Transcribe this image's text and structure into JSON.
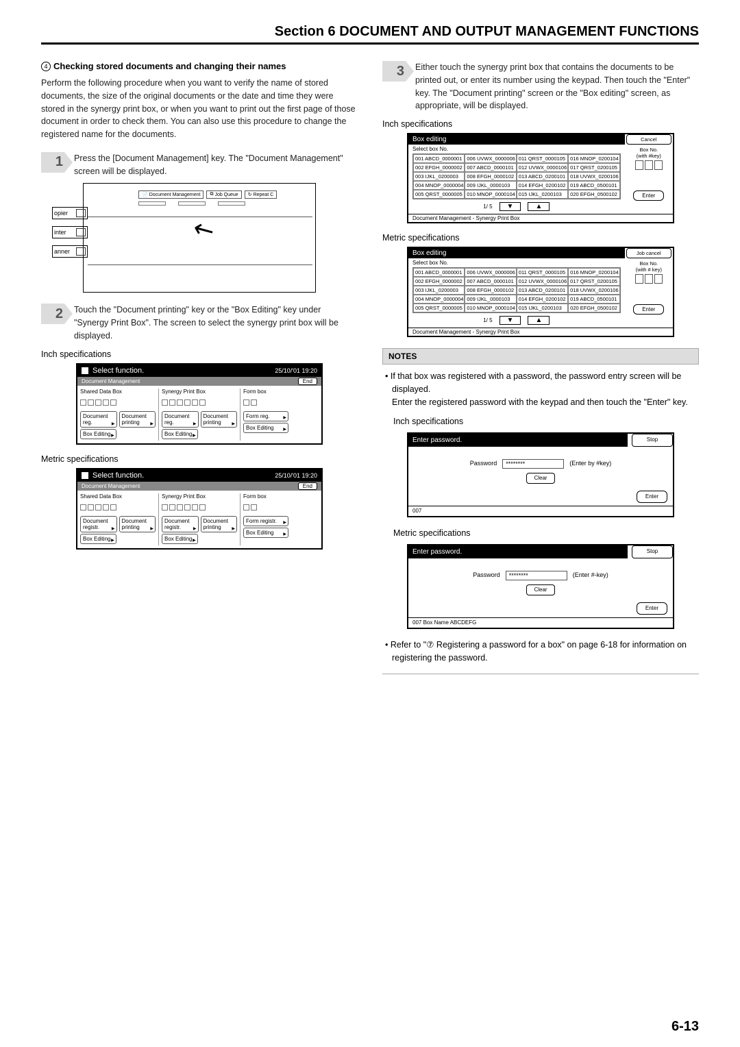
{
  "section_header": "Section 6  DOCUMENT AND OUTPUT MANAGEMENT FUNCTIONS",
  "left": {
    "sub_num": "4",
    "sub_title": "Checking stored documents and changing their names",
    "intro": "Perform the following procedure when you want to verify the name of stored documents, the size of the original documents or the date and time they were stored in the synergy print box, or when you want to print out the first page of those document in order to check them. You can also use this procedure to change the registered name for the documents.",
    "step1": "Press the [Document Management] key. The \"Document Management\" screen will be displayed.",
    "step2": "Touch the \"Document printing\" key or the \"Box Editing\" key under \"Synergy Print Box\". The screen to select the synergy print box will be displayed.",
    "inch_label": "Inch specifications",
    "metric_label": "Metric specifications"
  },
  "console": {
    "tab1": "Document Management",
    "tab2": "Job Queue",
    "tab3": "Repeat C",
    "side1": "opier",
    "side2": "inter",
    "side3": "anner"
  },
  "selectfn": {
    "title": "Select function.",
    "ts_inch": "25/10/'01 19:20",
    "ts_metric": "25/10/'01   19:20",
    "dm": "Document Management",
    "end": "End",
    "col1": "Shared Data Box",
    "col2": "Synergy Print Box",
    "col3": "Form box",
    "b1a_inch": "Document reg.",
    "b1a_metric": "Document registr.",
    "b1b": "Document printing",
    "b1c": "Box Editing",
    "b2a_inch": "Document reg.",
    "b2a_metric": "Document registr.",
    "b2b": "Document printing",
    "b2c": "Box Editing",
    "b3a_inch": "Form reg.",
    "b3a_metric": "Form registr.",
    "b3c": "Box Editing"
  },
  "right": {
    "step3": "Either touch the synergy print box that contains the documents to be printed out, or enter its number using the keypad. Then touch the \"Enter\" key. The \"Document printing\" screen or the \"Box editing\" screen, as appropriate, will be displayed.",
    "inch_label": "Inch specifications",
    "metric_label": "Metric specifications"
  },
  "boxedit": {
    "title": "Box editing",
    "cancel_inch": "Cancel",
    "cancel_metric": "Job cancel",
    "selrow": "Select box No.",
    "boxno": "Box No.",
    "withkey_inch": "(with #key)",
    "withkey_metric": "(with # key)",
    "cells": [
      [
        "001 ABCD_0000001",
        "006 UVWX_0000006",
        "011 QRST_0000105",
        "016 MNOP_0200104"
      ],
      [
        "002 EFGH_0000002",
        "007  ABCD_0000101",
        "012 UVWX_0000106",
        "017 QRST_0200105"
      ],
      [
        "003   IJKL_0200003",
        "008  EFGH_0000102",
        "013 ABCD_0200101",
        "018 UVWX_0200106"
      ],
      [
        "004 MNOP_0000004",
        "009   IJKL_0000103",
        "014 EFGH_0200102",
        "019 ABCD_0500101"
      ],
      [
        "005 QRST_0000005",
        "010 MNOP_0000104",
        "015   IJKL_0200103",
        "020 EFGH_0500102"
      ]
    ],
    "pager": "1/ 5",
    "enter": "Enter",
    "footer": "Document Management - Synergy Print Box"
  },
  "notes": {
    "title": "NOTES",
    "li1": "If that box was registered with a password, the password entry screen will be displayed.",
    "li1b": "Enter the registered password with the keypad and then touch the \"Enter\" key.",
    "inch_label": "Inch specifications",
    "metric_label": "Metric specifications"
  },
  "pwd": {
    "title": "Enter password.",
    "stop": "Stop",
    "label": "Password",
    "mask": "********",
    "hint_inch": "(Enter by #key)",
    "hint_metric": "(Enter #-key)",
    "clear": "Clear",
    "enter": "Enter",
    "footer_inch": "007",
    "footer_metric": "007   Box Name ABCDEFG"
  },
  "note2": "Refer to \"⑦  Registering a password for a box\" on page 6-18 for information on registering the password.",
  "page_num": "6-13"
}
